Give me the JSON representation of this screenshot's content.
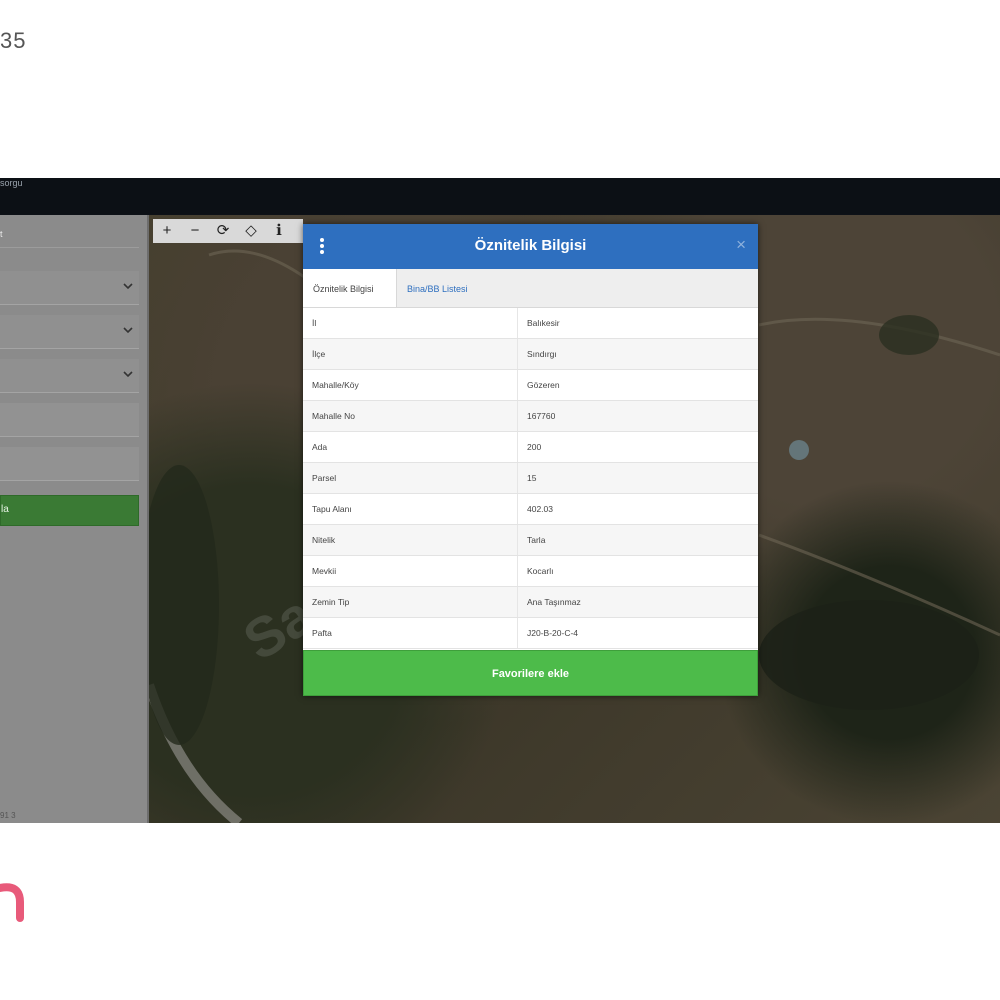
{
  "corner_number": "35",
  "app": {
    "title": "sorgu"
  },
  "sidebar": {
    "label": "t",
    "button_label": "la",
    "footer": "91 3"
  },
  "map": {
    "watermark": "Sa",
    "tools": [
      "+",
      "−",
      "⟳",
      "◇",
      "ℹ"
    ]
  },
  "dialog": {
    "title": "Öznitelik Bilgisi",
    "close": "×",
    "tabs": [
      "Öznitelik Bilgisi",
      "Bina/BB Listesi"
    ],
    "rows": [
      {
        "label": "İl",
        "value": "Balıkesir"
      },
      {
        "label": "İlçe",
        "value": "Sındırgı"
      },
      {
        "label": "Mahalle/Köy",
        "value": "Gözeren"
      },
      {
        "label": "Mahalle No",
        "value": "167760"
      },
      {
        "label": "Ada",
        "value": "200"
      },
      {
        "label": "Parsel",
        "value": "15"
      },
      {
        "label": "Tapu Alanı",
        "value": "402.03"
      },
      {
        "label": "Nitelik",
        "value": "Tarla"
      },
      {
        "label": "Mevkii",
        "value": "Kocarlı"
      },
      {
        "label": "Zemin Tip",
        "value": "Ana Taşınmaz"
      },
      {
        "label": "Pafta",
        "value": "J20-B-20-C-4"
      }
    ],
    "favorite_button": "Favorilere ekle"
  },
  "colors": {
    "header": "#2e6fbf",
    "favorite": "#4dbb4a",
    "sidebar_button": "#3a7a34"
  }
}
